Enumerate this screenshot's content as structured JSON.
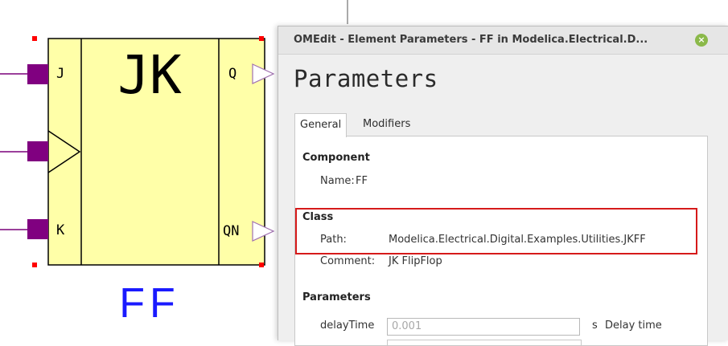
{
  "diagram": {
    "block_title": "JK",
    "instance_name": "FF",
    "ports": {
      "j": "J",
      "k": "K",
      "q": "Q",
      "qn": "QN"
    },
    "colors": {
      "body": "#ffffa8",
      "pin": "#800080",
      "name": "#1a1aff",
      "selection": "#ff0000"
    }
  },
  "dialog": {
    "title": "OMEdit - Element Parameters - FF in Modelica.Electrical.D...",
    "close_icon": "close-icon",
    "heading": "Parameters",
    "tabs": [
      "General",
      "Modifiers"
    ],
    "component": {
      "header": "Component",
      "name_label": "Name:",
      "name_value": "FF"
    },
    "class": {
      "header": "Class",
      "path_label": "Path:",
      "path_value": "Modelica.Electrical.Digital.Examples.Utilities.JKFF",
      "comment_label": "Comment:",
      "comment_value": "JK FlipFlop"
    },
    "parameters": {
      "header": "Parameters",
      "delay_label": "delayTime",
      "delay_placeholder": "0.001",
      "delay_unit": "s",
      "delay_desc": "Delay time"
    },
    "highlight_color": "#d61a1a"
  }
}
